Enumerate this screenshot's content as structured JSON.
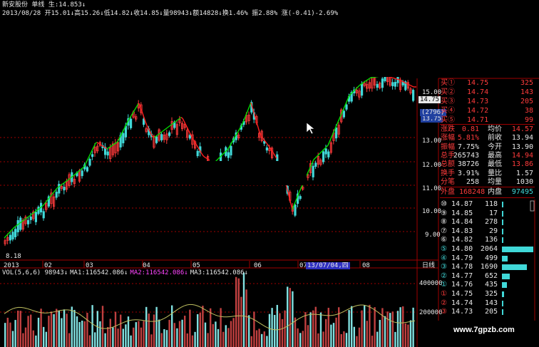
{
  "header": {
    "line1": "新安股份  单线  生:14.853↓",
    "line2_parts": [
      {
        "text": "2013/08/28 ",
        "color": "white"
      },
      {
        "text": "开15.01↓",
        "color": "white"
      },
      {
        "text": "高15.26↓",
        "color": "white"
      },
      {
        "text": "低14.82↓",
        "color": "white"
      },
      {
        "text": "收14.85↓",
        "color": "white"
      },
      {
        "text": "量98943↓",
        "color": "white"
      },
      {
        "text": "额14828↓",
        "color": "white"
      },
      {
        "text": "换1.46%",
        "color": "white"
      },
      {
        "text": " 振2.88%",
        "color": "white"
      },
      {
        "text": " 涨(-0.41)-2.69%",
        "color": "white"
      }
    ]
  },
  "price_axis": {
    "labels": [
      "15.00",
      "14.75",
      "13.75",
      "13.00",
      "12.00",
      "11.00",
      "10.00",
      "9.00"
    ],
    "badge_2796": "(2796)",
    "low_marker": "8.18"
  },
  "x_axis": {
    "labels": [
      "2013",
      "02",
      "03",
      "04",
      "05",
      "06",
      "07",
      "08"
    ],
    "cursor_date": "13/07/04,四",
    "period": "日线"
  },
  "volume": {
    "legend": [
      {
        "text": "VOL(5,6,6) 98943↓",
        "color": "white"
      },
      {
        "text": "MA1:116542.086↓",
        "color": "white"
      },
      {
        "text": "MA2:116542.086↓",
        "color": "magenta"
      },
      {
        "text": "MA3:116542.086↓",
        "color": "white"
      }
    ],
    "axis_labels": [
      "400000",
      "200000"
    ]
  },
  "quote_panel": {
    "bids": [
      {
        "label": "买①",
        "price": "14.75",
        "vol": "325"
      },
      {
        "label": "买②",
        "price": "14.74",
        "vol": "143"
      },
      {
        "label": "买③",
        "price": "14.73",
        "vol": "205"
      },
      {
        "label": "买④",
        "price": "14.72",
        "vol": "38"
      },
      {
        "label": "买⑤",
        "price": "14.71",
        "vol": "99"
      }
    ],
    "stats": [
      {
        "l1": "涨跌",
        "v1": "0.81",
        "c1": "red",
        "l2": "均价",
        "v2": "14.57",
        "c2": "red"
      },
      {
        "l1": "涨幅",
        "v1": "5.81%",
        "c1": "red",
        "l2": "前收",
        "v2": "13.94",
        "c2": "white"
      },
      {
        "l1": "振幅",
        "v1": "7.75%",
        "c1": "white",
        "l2": "今开",
        "v2": "13.90",
        "c2": "white"
      },
      {
        "l1": "总手",
        "v1": "265743",
        "c1": "white",
        "l2": "最高",
        "v2": "14.94",
        "c2": "red"
      },
      {
        "l1": "总额",
        "v1": "38726",
        "c1": "white",
        "l2": "最低",
        "v2": "13.86",
        "c2": "red"
      },
      {
        "l1": "换手",
        "v1": "3.91%",
        "c1": "white",
        "l2": "量比",
        "v2": "1.57",
        "c2": "white"
      },
      {
        "l1": "分笔",
        "v1": "258",
        "c1": "white",
        "l2": "均量",
        "v2": "1030",
        "c2": "white"
      }
    ],
    "outer": {
      "label": "外盘",
      "value": "168248"
    },
    "inner": {
      "label": "内盘",
      "value": "97495"
    },
    "ladder": [
      {
        "label": "⑩",
        "price": "14.87",
        "vol": "118",
        "fill": 0.02
      },
      {
        "label": "⑨",
        "price": "14.85",
        "vol": "17",
        "fill": 0.01
      },
      {
        "label": "⑧",
        "price": "14.84",
        "vol": "278",
        "fill": 0.05
      },
      {
        "label": "⑦",
        "price": "14.83",
        "vol": "29",
        "fill": 0.01
      },
      {
        "label": "⑥",
        "price": "14.82",
        "vol": "136",
        "fill": 0.02
      },
      {
        "label": "⑤",
        "price": "14.80",
        "vol": "2064",
        "fill": 1.0
      },
      {
        "label": "④",
        "price": "14.79",
        "vol": "499",
        "fill": 0.18
      },
      {
        "label": "③",
        "price": "14.78",
        "vol": "1690",
        "fill": 0.8
      },
      {
        "label": "②",
        "price": "14.77",
        "vol": "652",
        "fill": 0.24
      },
      {
        "label": "①",
        "price": "14.76",
        "vol": "435",
        "fill": 0.16
      },
      {
        "label": "①",
        "price": "14.75",
        "vol": "325",
        "fill": 0.06
      },
      {
        "label": "②",
        "price": "14.74",
        "vol": "143",
        "fill": 0.03
      },
      {
        "label": "③",
        "price": "14.73",
        "vol": "205",
        "fill": 0.04
      }
    ]
  },
  "watermark": "www.7gpzb.com",
  "colors": {
    "up": "#ff3b3b",
    "down": "#40d8d8",
    "ma_up": "#00e000",
    "ma_down": "#ff2020",
    "grid": "#a00000",
    "highlight": "#3030c0"
  }
}
